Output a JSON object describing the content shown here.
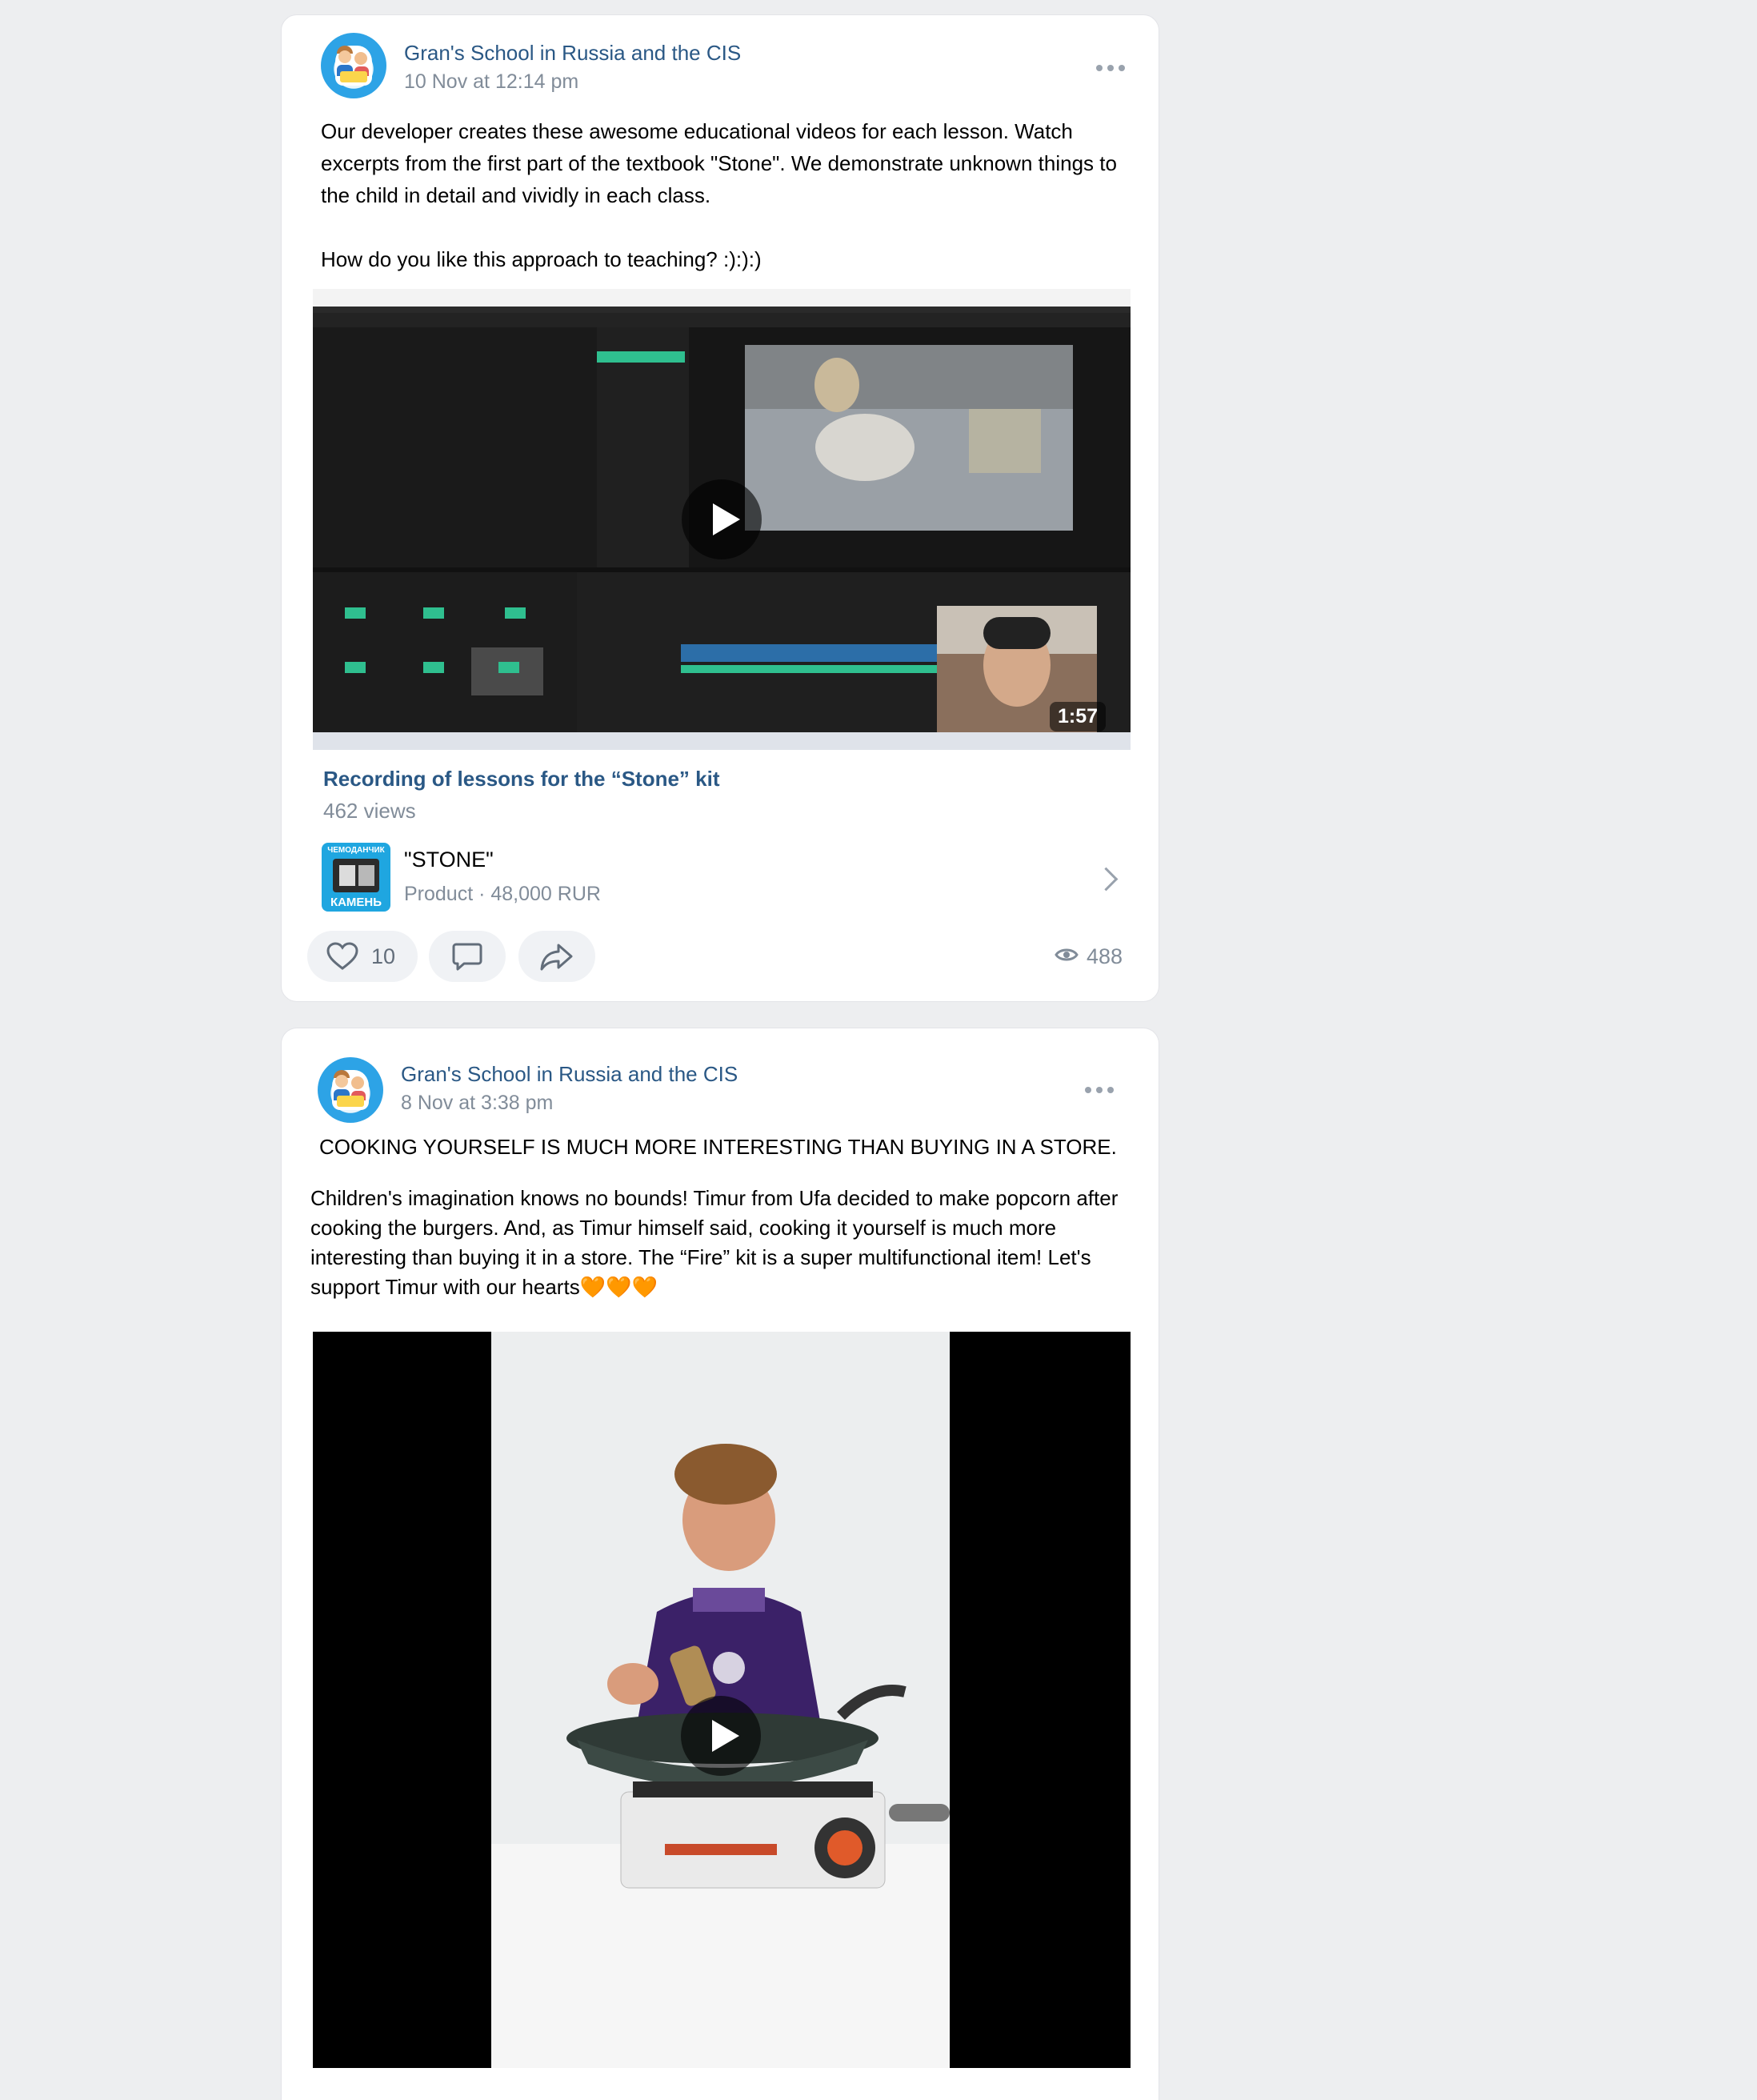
{
  "posts": [
    {
      "author": "Gran's School in Russia and the CIS",
      "date": "10 Nov at 12:14 pm",
      "text_lines": [
        "Our developer creates these awesome educational videos for each lesson. Watch",
        "excerpts from the first part of the textbook \"Stone\". We demonstrate unknown things to",
        "the child in detail and vividly in each class.",
        "",
        "How do you like this approach to teaching? :):):)"
      ],
      "video": {
        "duration": "1:57",
        "title": "Recording of lessons for the “Stone” kit",
        "views": "462 views"
      },
      "product": {
        "thumb_label_top": "ЧЕМОДАНЧИК",
        "thumb_label_bottom": "КАМЕНЬ",
        "name": "\"STONE\"",
        "meta": "Product · 48,000 RUR"
      },
      "likes": "10",
      "views": "488"
    },
    {
      "author": "Gran's School in Russia and the CIS",
      "date": "8 Nov at 3:38 pm",
      "headline": "COOKING YOURSELF IS MUCH MORE INTERESTING THAN BUYING IN A STORE.",
      "text_lines": [
        "Children's imagination knows no bounds! Timur from Ufa decided to make popcorn after",
        "cooking the burgers. And, as Timur himself said, cooking it yourself is much more",
        "interesting than buying it in a store. The “Fire” kit is a super multifunctional item! Let's",
        "support Timur with our hearts🧡🧡🧡"
      ]
    }
  ],
  "colors": {
    "background": "#edeef0",
    "link": "#2a5885",
    "secondary": "#818c99"
  }
}
